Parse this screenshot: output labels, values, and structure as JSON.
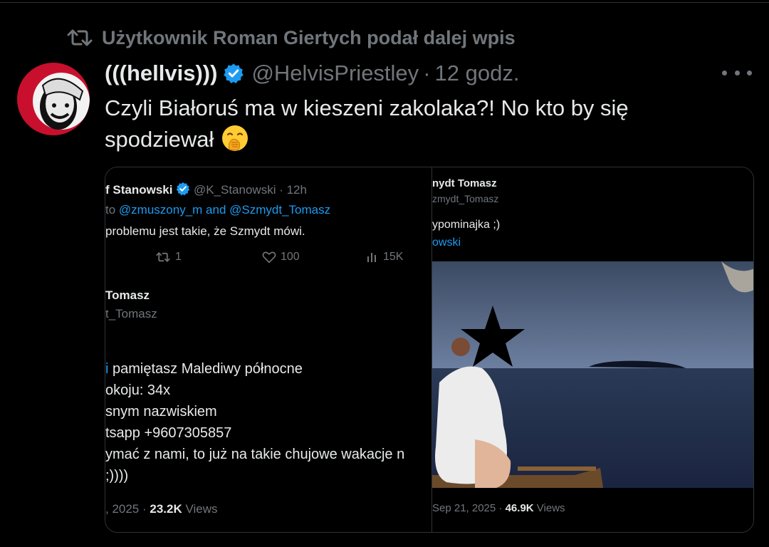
{
  "retweet": {
    "text": "Użytkownik Roman Giertych podał dalej wpis"
  },
  "author": {
    "name": "(((hellvis)))",
    "handle": "@HelvisPriestley",
    "separator": "·",
    "time": "12 godz."
  },
  "tweet": {
    "line1": "Czyli Białoruś ma w kieszeni zakolaka?! No kto by się",
    "line2": "spodziewał"
  },
  "embed_left": {
    "name": "f Stanowski",
    "handle": "@K_Stanowski",
    "time": "· 12h",
    "reply_prefix": "to",
    "reply_mentions": "@zmuszony_m and @Szmydt_Tomasz",
    "text": "problemu jest takie, że Szmydt mówi.",
    "retweets": "1",
    "likes": "100",
    "views": "15K",
    "quoted_name": "Tomasz",
    "quoted_handle": "t_Tomasz",
    "quoted_lines": [
      "i",
      "pamiętasz Malediwy północne",
      "okoju: 34x",
      "snym nazwiskiem",
      "tsapp +9607305857",
      "ymać z nami, to już na takie chujowe wakacje n",
      ";))))"
    ],
    "footer_date": ", 2025 ·",
    "footer_views": "23.2K",
    "footer_views_label": "Views"
  },
  "embed_right": {
    "name": "nydt Tomasz",
    "handle": "zmydt_Tomasz",
    "text": "ypominajka ;)",
    "link": "owski",
    "footer_date": "Sep 21, 2025 ·",
    "footer_views": "46.9K",
    "footer_views_label": "Views"
  },
  "colors": {
    "accent": "#1d9bf0",
    "muted": "#71767b",
    "text": "#e7e9ea",
    "background": "#000000"
  }
}
